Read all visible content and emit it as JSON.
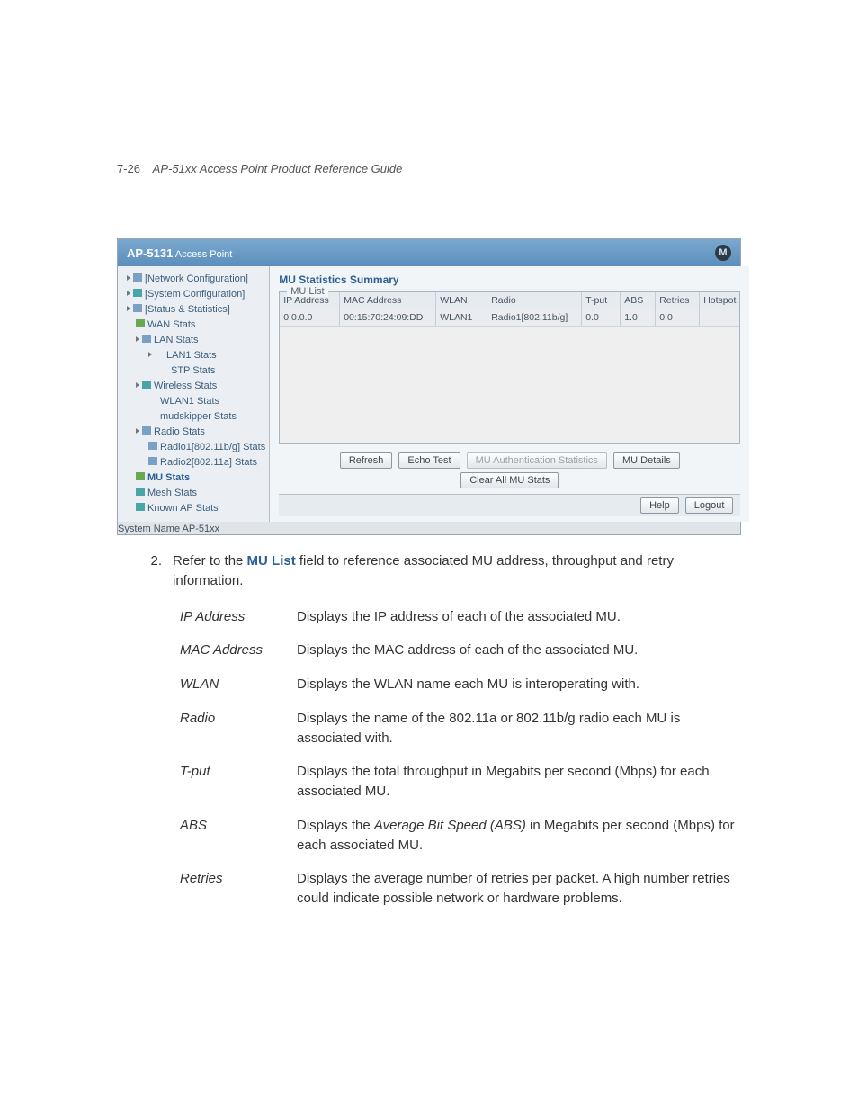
{
  "page_header": {
    "number": "7-26",
    "guide_title": "AP-51xx Access Point Product Reference Guide"
  },
  "ui": {
    "titlebar": {
      "product": "AP-5131",
      "product_suffix": "Access Point",
      "logo_letter": "M"
    },
    "tree": {
      "net_conf": "[Network Configuration]",
      "sys_conf": "[System Configuration]",
      "stats": "[Status & Statistics]",
      "wan_stats": "WAN Stats",
      "lan_stats": "LAN Stats",
      "lan1_stats": "LAN1 Stats",
      "stp_stats": "STP Stats",
      "wireless_stats": "Wireless Stats",
      "wlan1_stats": "WLAN1 Stats",
      "mudskipper": "mudskipper Stats",
      "radio_stats": "Radio Stats",
      "radio1": "Radio1[802.11b/g] Stats",
      "radio2": "Radio2[802.11a] Stats",
      "mu_stats": "MU Stats",
      "mesh_stats": "Mesh Stats",
      "known_ap": "Known AP Stats"
    },
    "panel_title": "MU Statistics Summary",
    "groupbox_label": "MU List",
    "columns": {
      "ip": "IP Address",
      "mac": "MAC Address",
      "wlan": "WLAN",
      "radio": "Radio",
      "tput": "T-put",
      "abs": "ABS",
      "retries": "Retries",
      "hotspot": "Hotspot"
    },
    "row": {
      "ip": "0.0.0.0",
      "mac": "00:15:70:24:09:DD",
      "wlan": "WLAN1",
      "radio": "Radio1[802.11b/g]",
      "tput": "0.0",
      "abs": "1.0",
      "retries": "0.0",
      "hotspot": ""
    },
    "buttons": {
      "refresh": "Refresh",
      "echo": "Echo Test",
      "auth": "MU Authentication Statistics",
      "details": "MU Details",
      "clear": "Clear All MU Stats",
      "help": "Help",
      "logout": "Logout"
    },
    "status_bar": "System Name AP-51xx"
  },
  "instruction": {
    "number": "2.",
    "pre": "Refer to the ",
    "kw": "MU List",
    "post": " field to reference associated MU address, throughput and retry information."
  },
  "defs": {
    "ip": {
      "term": "IP Address",
      "body": "Displays the IP address of each of the associated MU."
    },
    "mac": {
      "term": "MAC Address",
      "body": "Displays the MAC address of each of the associated MU."
    },
    "wlan": {
      "term": "WLAN",
      "body": "Displays the WLAN name each MU is interoperating with."
    },
    "radio": {
      "term": "Radio",
      "body": "Displays the name of the 802.11a or 802.11b/g radio each MU is associated with."
    },
    "tput": {
      "term": "T-put",
      "body": "Displays the total throughput in Megabits per second (Mbps) for each associated MU."
    },
    "abs": {
      "term": "ABS",
      "pre": "Displays the ",
      "em": "Average Bit Speed (ABS)",
      "post": " in Megabits per second (Mbps) for each associated MU."
    },
    "retries": {
      "term": "Retries",
      "body": "Displays the average number of retries per packet. A high number retries could indicate possible network or hardware problems."
    }
  }
}
